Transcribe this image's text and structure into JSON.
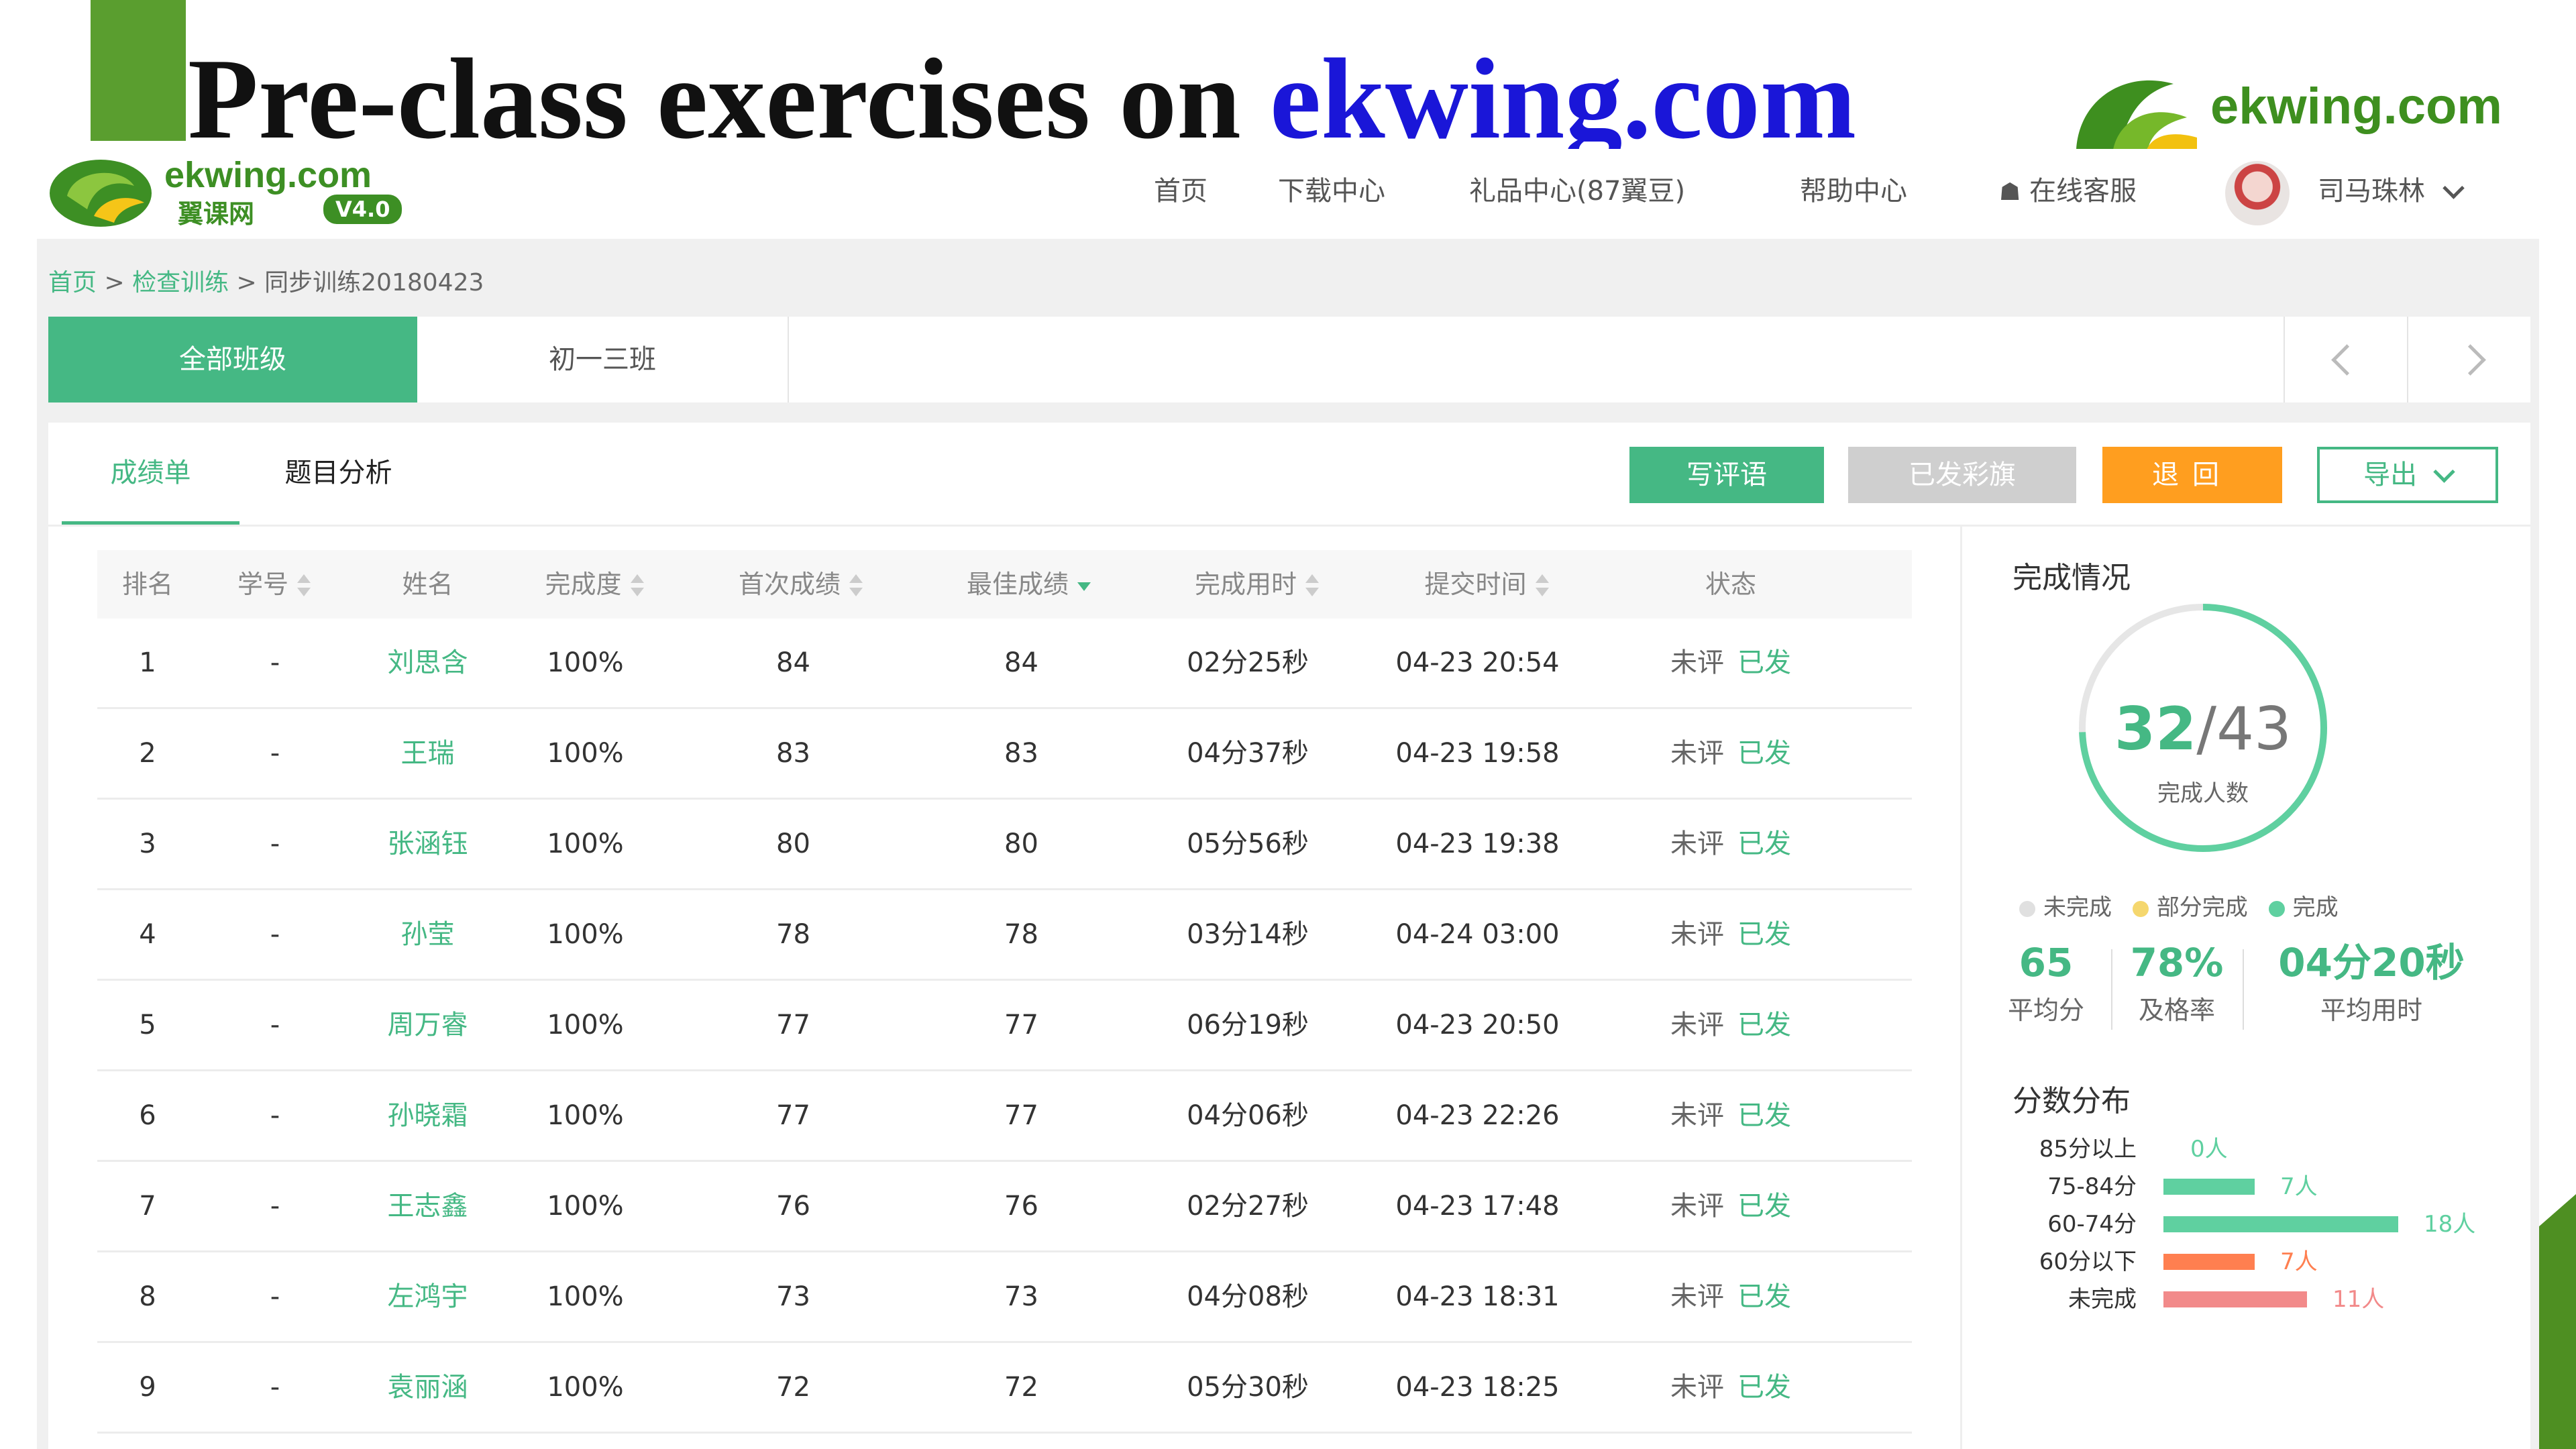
{
  "slide": {
    "title_black": "Pre-class exercises on ",
    "title_blue": "ekwing.com",
    "corner_logo_text": "ekwing.com"
  },
  "site": {
    "logo_text": "ekwing.com",
    "logo_subtext": "翼课网",
    "logo_version": "V4.0",
    "nav": [
      "首页",
      "下载中心",
      "礼品中心(87翼豆)",
      "帮助中心"
    ],
    "online_service": "在线客服",
    "user_name": "司马珠林"
  },
  "breadcrumb": {
    "home": "首页",
    "sep1": " > ",
    "check": "检查训练",
    "sep2": " > ",
    "current": "同步训练20180423"
  },
  "class_tabs": [
    "全部班级",
    "初一三班"
  ],
  "sub_tabs": [
    "成绩单",
    "题目分析"
  ],
  "buttons": {
    "write_comment": "写评语",
    "flag_sent": "已发彩旗",
    "return": "退回",
    "export": "导出"
  },
  "table": {
    "headers": [
      "排名",
      "学号",
      "姓名",
      "完成度",
      "首次成绩",
      "最佳成绩",
      "完成用时",
      "提交时间",
      "状态"
    ],
    "rows": [
      {
        "rank": "1",
        "id": "-",
        "name": "刘思含",
        "completion": "100%",
        "first": "84",
        "best": "84",
        "time": "02分25秒",
        "submitted": "04-23 20:54",
        "review": "未评",
        "sent": "已发"
      },
      {
        "rank": "2",
        "id": "-",
        "name": "王瑞",
        "completion": "100%",
        "first": "83",
        "best": "83",
        "time": "04分37秒",
        "submitted": "04-23 19:58",
        "review": "未评",
        "sent": "已发"
      },
      {
        "rank": "3",
        "id": "-",
        "name": "张涵钰",
        "completion": "100%",
        "first": "80",
        "best": "80",
        "time": "05分56秒",
        "submitted": "04-23 19:38",
        "review": "未评",
        "sent": "已发"
      },
      {
        "rank": "4",
        "id": "-",
        "name": "孙莹",
        "completion": "100%",
        "first": "78",
        "best": "78",
        "time": "03分14秒",
        "submitted": "04-24 03:00",
        "review": "未评",
        "sent": "已发"
      },
      {
        "rank": "5",
        "id": "-",
        "name": "周万睿",
        "completion": "100%",
        "first": "77",
        "best": "77",
        "time": "06分19秒",
        "submitted": "04-23 20:50",
        "review": "未评",
        "sent": "已发"
      },
      {
        "rank": "6",
        "id": "-",
        "name": "孙晓霜",
        "completion": "100%",
        "first": "77",
        "best": "77",
        "time": "04分06秒",
        "submitted": "04-23 22:26",
        "review": "未评",
        "sent": "已发"
      },
      {
        "rank": "7",
        "id": "-",
        "name": "王志鑫",
        "completion": "100%",
        "first": "76",
        "best": "76",
        "time": "02分27秒",
        "submitted": "04-23 17:48",
        "review": "未评",
        "sent": "已发"
      },
      {
        "rank": "8",
        "id": "-",
        "name": "左鸿宇",
        "completion": "100%",
        "first": "73",
        "best": "73",
        "time": "04分08秒",
        "submitted": "04-23 18:31",
        "review": "未评",
        "sent": "已发"
      },
      {
        "rank": "9",
        "id": "-",
        "name": "袁丽涵",
        "completion": "100%",
        "first": "72",
        "best": "72",
        "time": "05分30秒",
        "submitted": "04-23 18:25",
        "review": "未评",
        "sent": "已发"
      }
    ]
  },
  "completion": {
    "title": "完成情况",
    "done": "32",
    "total": "/43",
    "label": "完成人数",
    "fraction": 0.744,
    "legend": [
      "未完成",
      "部分完成",
      "完成"
    ],
    "legend_colors": [
      "#e0e0e0",
      "#f5d76e",
      "#5fd0a0"
    ],
    "stats": [
      {
        "value": "65",
        "label": "平均分"
      },
      {
        "value": "78%",
        "label": "及格率"
      },
      {
        "value": "04分20秒",
        "label": "平均用时"
      }
    ]
  },
  "distribution": {
    "title": "分数分布",
    "max": 18,
    "rows": [
      {
        "label": "85分以上",
        "count": 0,
        "text": "0人",
        "color": "#5fd0a0"
      },
      {
        "label": "75-84分",
        "count": 7,
        "text": "7人",
        "color": "#5fd0a0"
      },
      {
        "label": "60-74分",
        "count": 18,
        "text": "18人",
        "color": "#5fd0a0"
      },
      {
        "label": "60分以下",
        "count": 7,
        "text": "7人",
        "color": "#ff7f50"
      },
      {
        "label": "未完成",
        "count": 11,
        "text": "11人",
        "color": "#f28a8a"
      }
    ]
  },
  "colors": {
    "accent": "#45b884",
    "title_blue": "#1a16d8",
    "orange": "#ff9e1f"
  }
}
